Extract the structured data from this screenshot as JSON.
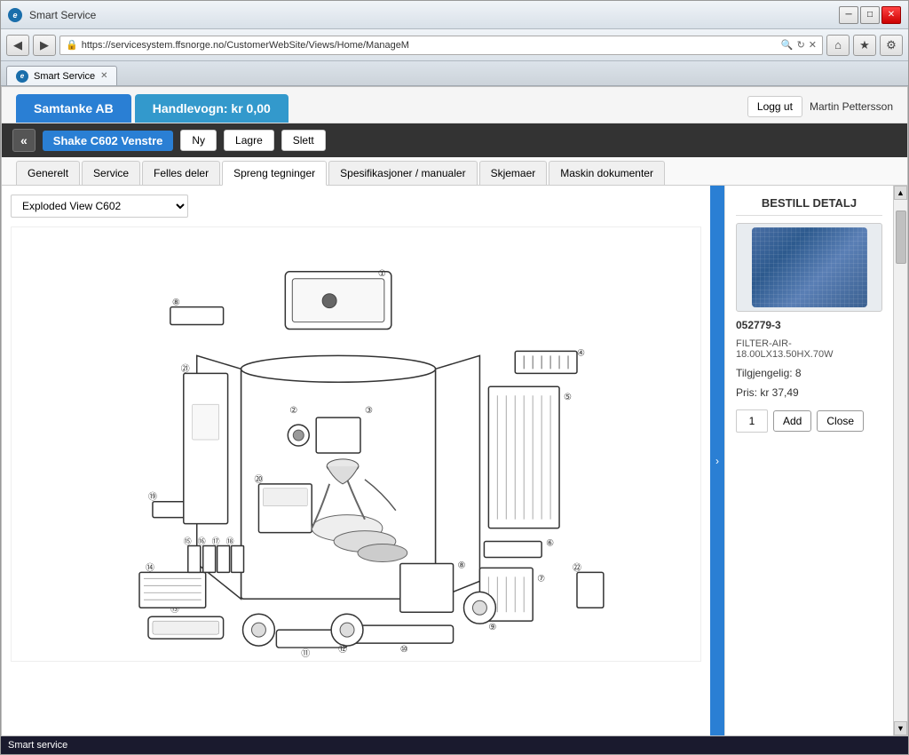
{
  "browser": {
    "title": "Smart Service",
    "url": "https://servicesystem.ffsnorge.no/CustomerWebSite/Views/Home/ManageM",
    "tab_label": "Smart Service",
    "back_icon": "◀",
    "forward_icon": "▶",
    "minimize_icon": "─",
    "maximize_icon": "□",
    "close_icon": "✕",
    "search_icon": "🔍",
    "lock_icon": "🔒",
    "refresh_icon": "↻",
    "x_icon": "✕",
    "home_icon": "⌂",
    "star_icon": "★",
    "gear_icon": "⚙"
  },
  "header": {
    "company_tab": "Samtanke AB",
    "cart_tab": "Handlevogn: kr 0,00",
    "logout_btn": "Logg ut",
    "username": "Martin Pettersson"
  },
  "machine_nav": {
    "back_icon": "«",
    "machine_name": "Shake C602 Venstre",
    "new_btn": "Ny",
    "save_btn": "Lagre",
    "delete_btn": "Slett"
  },
  "content_tabs": [
    {
      "label": "Generelt",
      "active": false
    },
    {
      "label": "Service",
      "active": false
    },
    {
      "label": "Felles deler",
      "active": false
    },
    {
      "label": "Spreng tegninger",
      "active": true
    },
    {
      "label": "Spesifikasjoner / manualer",
      "active": false
    },
    {
      "label": "Skjemaer",
      "active": false
    },
    {
      "label": "Maskin dokumenter",
      "active": false
    }
  ],
  "diagram": {
    "view_label": "Exploded View C602",
    "dropdown_options": [
      "Exploded View C602"
    ]
  },
  "right_panel": {
    "title": "BESTILL DETALJ",
    "product_code": "052779-3",
    "product_name": "FILTER-AIR-18.00LX13.50HX.70W",
    "availability_label": "Tilgjengelig: 8",
    "price_label": "Pris: kr 37,49",
    "qty_value": "1",
    "add_btn": "Add",
    "close_btn": "Close",
    "toggle_icon": "›"
  },
  "status_bar": {
    "text": "Smart service"
  }
}
